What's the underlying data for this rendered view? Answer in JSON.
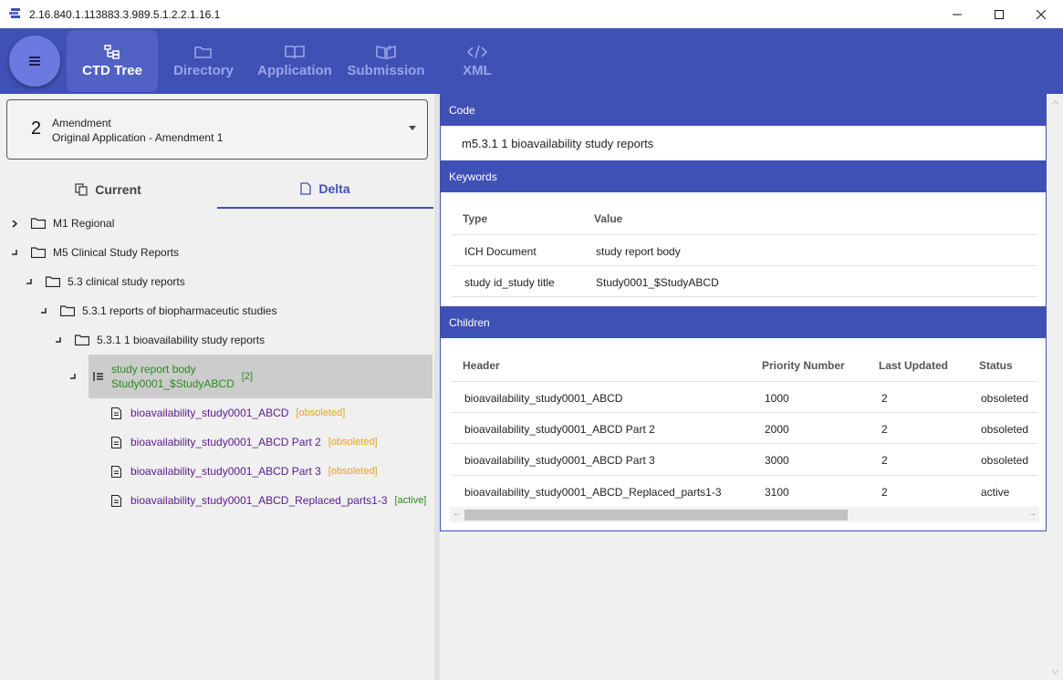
{
  "window": {
    "title": "2.16.840.1.113883.3.989.5.1.2.2.1.16.1"
  },
  "nav": {
    "menu_icon": "hamburger-icon",
    "tabs": [
      {
        "label": "CTD Tree",
        "icon": "tree-icon",
        "active": true
      },
      {
        "label": "Directory",
        "icon": "folder-icon",
        "active": false
      },
      {
        "label": "Application",
        "icon": "book-icon",
        "active": false
      },
      {
        "label": "Submission",
        "icon": "open-book-icon",
        "active": false
      },
      {
        "label": "XML",
        "icon": "code-icon",
        "active": false
      }
    ]
  },
  "selector": {
    "number": "2",
    "type": "Amendment",
    "description": "Original Application - Amendment 1"
  },
  "subtabs": {
    "current": "Current",
    "delta": "Delta"
  },
  "tree": {
    "m1": "M1 Regional",
    "m5": "M5 Clinical Study Reports",
    "s53": "5.3 clinical study reports",
    "s531": "5.3.1 reports of biopharmaceutic studies",
    "s5311": "5.3.1 1 bioavailability study reports",
    "selected_line1": "study report body",
    "selected_line2": "Study0001_$StudyABCD",
    "selected_count": "[2]",
    "docs": [
      {
        "name": "bioavailability_study0001_ABCD",
        "status": "[obsoleted]"
      },
      {
        "name": "bioavailability_study0001_ABCD Part 2",
        "status": "[obsoleted]"
      },
      {
        "name": "bioavailability_study0001_ABCD Part 3",
        "status": "[obsoleted]"
      },
      {
        "name": "bioavailability_study0001_ABCD_Replaced_parts1-3",
        "status": "[active]"
      }
    ]
  },
  "detail": {
    "code_header": "Code",
    "code_value": "m5.3.1 1 bioavailability study reports",
    "keywords_header": "Keywords",
    "keywords_columns": {
      "type": "Type",
      "value": "Value"
    },
    "keywords": [
      {
        "type": "ICH Document",
        "value": "study report body"
      },
      {
        "type": "study id_study title",
        "value": "Study0001_$StudyABCD"
      }
    ],
    "children_header": "Children",
    "children_columns": {
      "header": "Header",
      "priority": "Priority Number",
      "updated": "Last Updated",
      "status": "Status"
    },
    "children": [
      {
        "header": "bioavailability_study0001_ABCD",
        "priority": "1000",
        "updated": "2",
        "status": "obsoleted"
      },
      {
        "header": "bioavailability_study0001_ABCD Part 2",
        "priority": "2000",
        "updated": "2",
        "status": "obsoleted"
      },
      {
        "header": "bioavailability_study0001_ABCD Part 3",
        "priority": "3000",
        "updated": "2",
        "status": "obsoleted"
      },
      {
        "header": "bioavailability_study0001_ABCD_Replaced_parts1-3",
        "priority": "3100",
        "updated": "2",
        "status": "active"
      }
    ]
  },
  "colors": {
    "primary": "#3f51b5",
    "obsoleted": "#e8a317",
    "active": "#2a8a1e",
    "doc_link": "#5a1a8c"
  }
}
